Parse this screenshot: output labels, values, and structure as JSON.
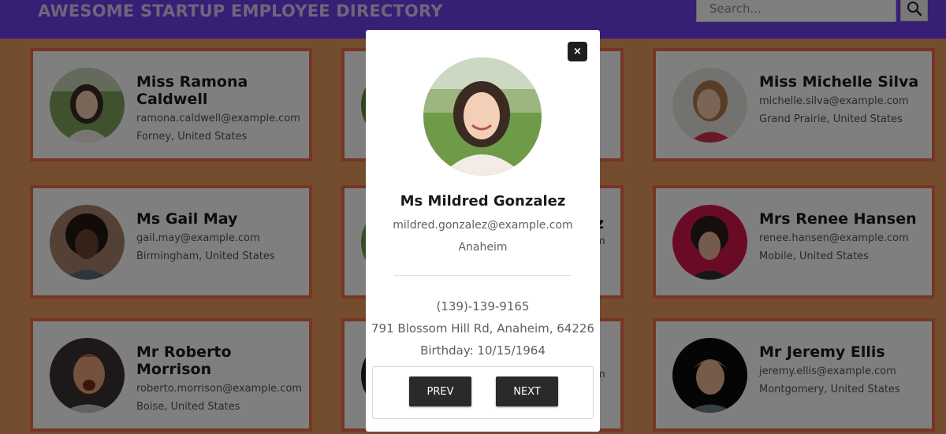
{
  "header": {
    "title": "AWESOME STARTUP EMPLOYEE DIRECTORY",
    "search_placeholder": "Search...",
    "search_icon": "magnifier-icon"
  },
  "employees": [
    {
      "name": "Miss Ramona Caldwell",
      "email": "ramona.caldwell@example.com",
      "location": "Forney, United States",
      "avatar": "woman-green-background"
    },
    {
      "name": "",
      "email": "",
      "location": "",
      "avatar": "person-green-background"
    },
    {
      "name": "Miss Michelle Silva",
      "email": "michelle.silva@example.com",
      "location": "Grand Prairie, United States",
      "avatar": "woman-smiling"
    },
    {
      "name": "Ms Gail May",
      "email": "gail.may@example.com",
      "location": "Birmingham, United States",
      "avatar": "woman-curly-hair"
    },
    {
      "name": "",
      "email": "",
      "location": "",
      "avatar": "person-green-background"
    },
    {
      "name": "Mrs Renee Hansen",
      "email": "renee.hansen@example.com",
      "location": "Mobile, United States",
      "avatar": "woman-pink-background"
    },
    {
      "name": "Mr Roberto Morrison",
      "email": "roberto.morrison@example.com",
      "location": "Boise, United States",
      "avatar": "man-excited"
    },
    {
      "name": "",
      "email": "",
      "location": "",
      "avatar": "person-dark-background"
    },
    {
      "name": "Mr Jeremy Ellis",
      "email": "jeremy.ellis@example.com",
      "location": "Montgomery, United States",
      "avatar": "man-dark-background"
    }
  ],
  "partial_text": {
    "row2_letter": "z",
    "row2_fragment": "m",
    "row3_fragment": "m"
  },
  "modal": {
    "name": "Ms Mildred Gonzalez",
    "email": "mildred.gonzalez@example.com",
    "city": "Anaheim",
    "phone": "(139)-139-9165",
    "address": "791 Blossom Hill Rd, Anaheim, 64226",
    "birthday": "Birthday: 10/15/1964",
    "close_label": "×",
    "prev_label": "PREV",
    "next_label": "NEXT"
  },
  "colors": {
    "header_bg": "#6d3fe9",
    "page_bg": "#e99a5e",
    "card_border": "#ef6b48",
    "button_bg": "#2a2a2a"
  }
}
